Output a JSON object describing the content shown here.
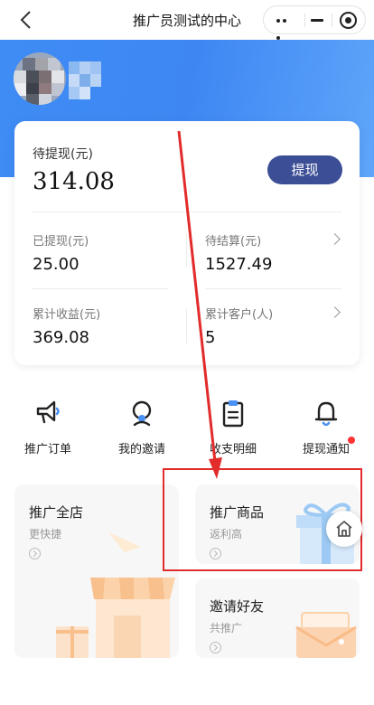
{
  "nav": {
    "title": "推广员测试的中心",
    "back_icon": "chevron-left-icon",
    "capsule": {
      "more_icon": "more-dots-icon",
      "min_icon": "minimize-icon",
      "close_icon": "close-circle-icon"
    }
  },
  "colors": {
    "header_blue": "#3f8cf5",
    "button_navy": "#3c4e95",
    "highlight_red": "#e22b2b",
    "icon_blue": "#4a90f5"
  },
  "profile": {
    "avatar_icon": "avatar-image",
    "name_blurred": true
  },
  "balance": {
    "pending_label": "待提现(元)",
    "pending_value": "314.08",
    "withdraw_button": "提现",
    "stats": [
      {
        "label": "已提现(元)",
        "value": "25.00"
      },
      {
        "label": "待结算(元)",
        "value": "1527.49"
      },
      {
        "label": "累计收益(元)",
        "value": "369.08"
      },
      {
        "label": "累计客户(人)",
        "value": "5"
      }
    ]
  },
  "menu": [
    {
      "label": "推广订单",
      "icon": "megaphone-icon"
    },
    {
      "label": "我的邀请",
      "icon": "user-invite-icon"
    },
    {
      "label": "收支明细",
      "icon": "clipboard-icon"
    },
    {
      "label": "提现通知",
      "icon": "bell-icon"
    }
  ],
  "promos": [
    {
      "title": "推广全店",
      "subtitle": "更快捷",
      "icon": "storefront-illustration"
    },
    {
      "title": "推广商品",
      "subtitle": "返利高",
      "icon": "gift-box-illustration"
    },
    {
      "title": "邀请好友",
      "subtitle": "共推广",
      "icon": "envelope-illustration"
    }
  ],
  "home_button_icon": "home-icon"
}
